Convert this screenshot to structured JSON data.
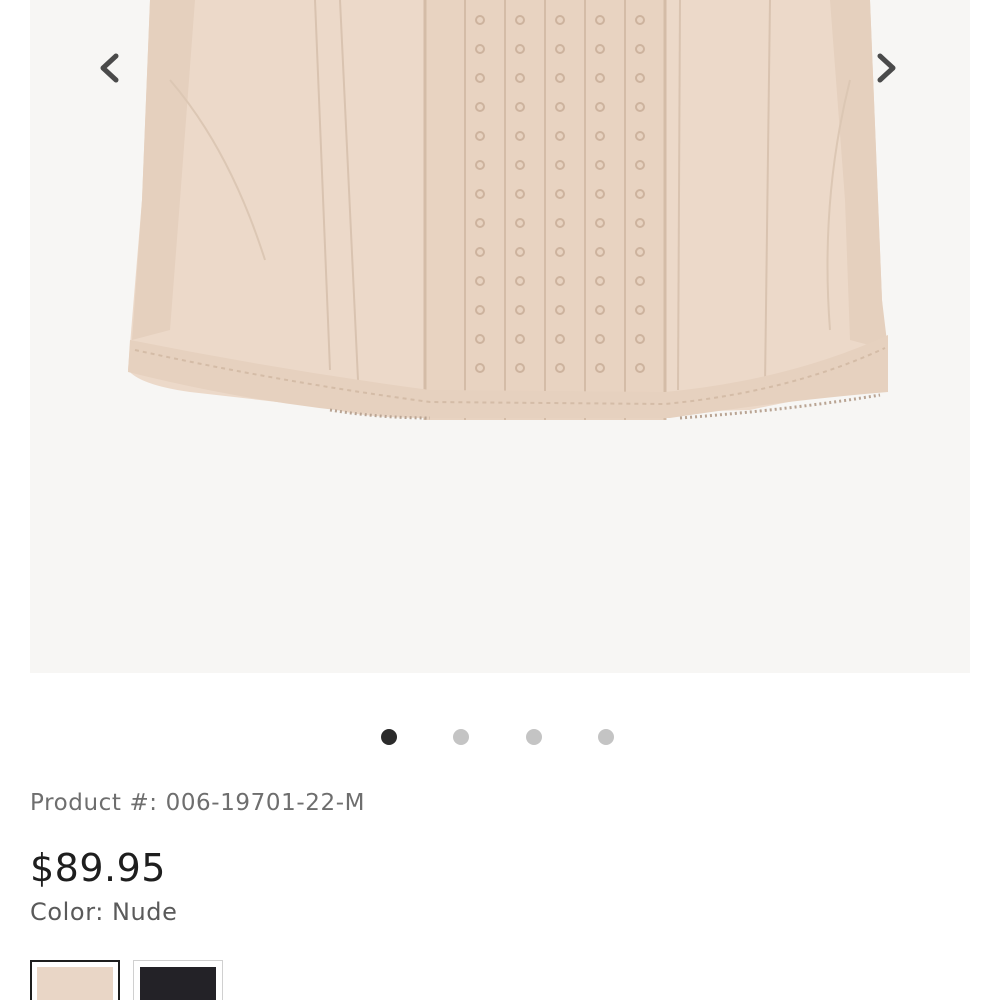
{
  "gallery": {
    "image_alt": "Nude corset shapewear with hook-and-eye front closure",
    "prev_icon": "chevron-left-icon",
    "next_icon": "chevron-right-icon",
    "slide_count": 4,
    "active_slide": 1
  },
  "product": {
    "number_label": "Product #:",
    "number_value": "006-19701-22-M",
    "price": "$89.95",
    "color_label": "Color:",
    "color_value": "Nude"
  },
  "swatches": [
    {
      "name": "Nude",
      "color": "#e9d6c6",
      "selected": true
    },
    {
      "name": "Black",
      "color": "#232227",
      "selected": false
    }
  ],
  "colors": {
    "arrow": "#4a4a4a",
    "dot_active": "#2b2b2b",
    "dot_inactive": "#c4c4c4",
    "garment": "#ecd9c9"
  }
}
